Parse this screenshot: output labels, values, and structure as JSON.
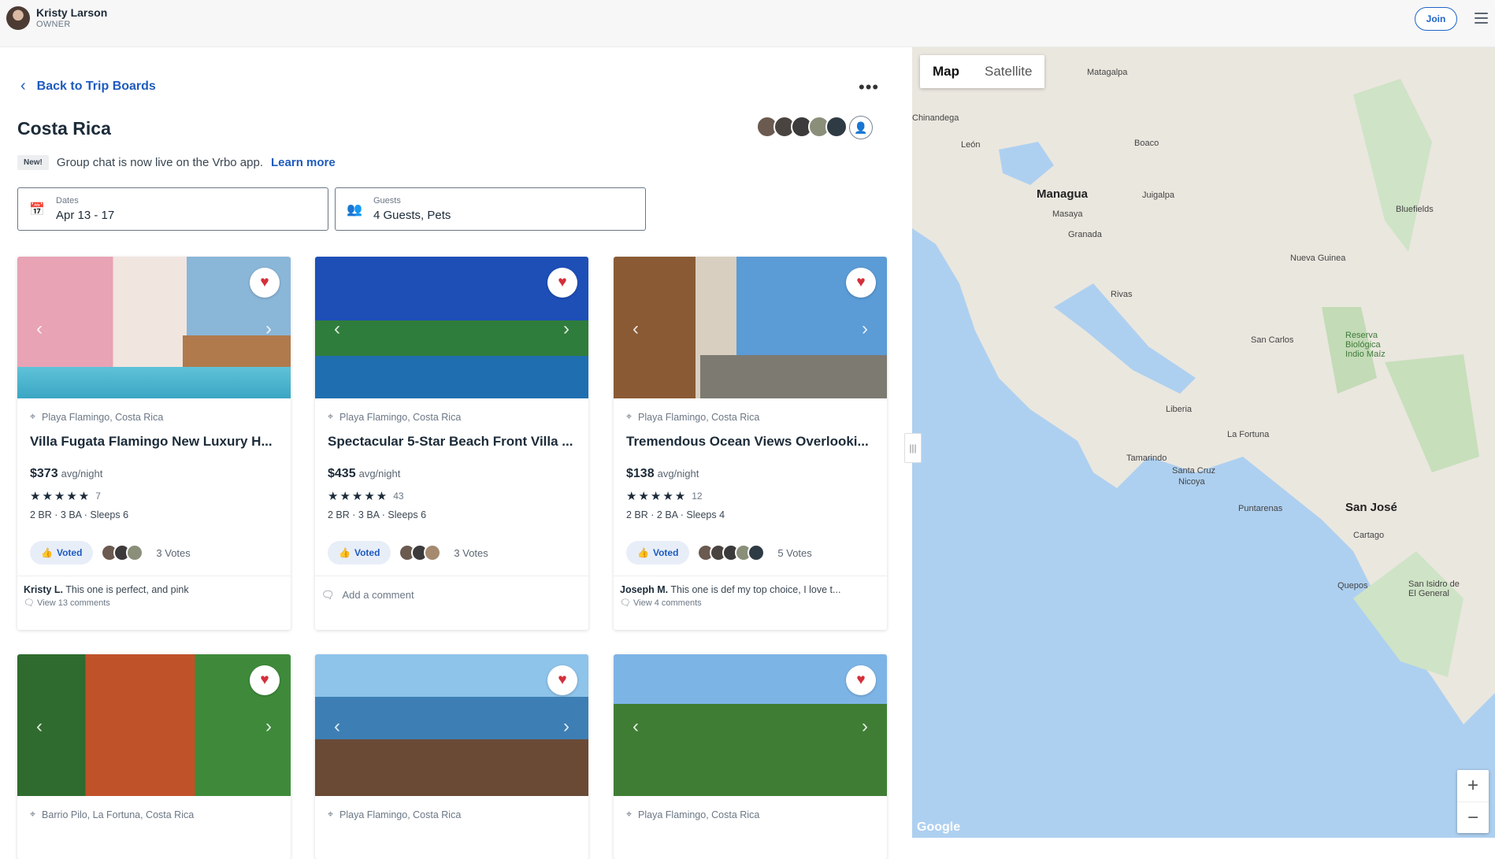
{
  "user": {
    "name": "Kristy Larson",
    "role": "OWNER"
  },
  "header": {
    "join_label": "Join"
  },
  "board": {
    "back_label": "Back to Trip Boards",
    "more_label": "•••",
    "title": "Costa Rica",
    "banner_badge": "New!",
    "banner_text": "Group chat is now live on the Vrbo app.",
    "banner_link": "Learn more",
    "dates_label": "Dates",
    "dates_value": "Apr 13 - 17",
    "guests_label": "Guests",
    "guests_value": "4 Guests, Pets"
  },
  "listings": [
    {
      "location": "Playa Flamingo, Costa Rica",
      "title": "Villa Fugata Flamingo New Luxury H...",
      "price": "$373",
      "price_unit": "avg/night",
      "rating": 5,
      "reviews": "7",
      "specs": "2 BR  ·  3 BA  ·  Sleeps 6",
      "voted_label": "Voted",
      "votes": "3 Votes",
      "comment_author": "Kristy L.",
      "comment_text": "This one is perfect, and pink",
      "comment_link": "View 13 comments"
    },
    {
      "location": "Playa Flamingo, Costa Rica",
      "title": "Spectacular 5-Star Beach Front Villa ...",
      "price": "$435",
      "price_unit": "avg/night",
      "rating": 5,
      "reviews": "43",
      "specs": "2 BR  ·  3 BA  ·  Sleeps 6",
      "voted_label": "Voted",
      "votes": "3 Votes",
      "add_comment": "Add a comment"
    },
    {
      "location": "Playa Flamingo, Costa Rica",
      "title": "Tremendous Ocean Views Overlooki...",
      "price": "$138",
      "price_unit": "avg/night",
      "rating": 5,
      "reviews": "12",
      "specs": "2 BR  ·  2 BA  ·  Sleeps 4",
      "voted_label": "Voted",
      "votes": "5 Votes",
      "comment_author": "Joseph M.",
      "comment_text": "This one is def my top choice, I love t...",
      "comment_link": "View 4 comments"
    },
    {
      "location": "Barrio Pilo, La Fortuna, Costa Rica"
    },
    {
      "location": "Playa Flamingo, Costa Rica"
    },
    {
      "location": "Playa Flamingo, Costa Rica"
    }
  ],
  "map": {
    "tab_map": "Map",
    "tab_satellite": "Satellite",
    "zoom_in": "+",
    "zoom_out": "−",
    "attribution": "Google",
    "cities": [
      "Managua",
      "Masaya",
      "Granada",
      "León",
      "Chinandega",
      "Matagalpa",
      "Boaco",
      "Juigalpa",
      "Rivas",
      "Liberia",
      "Santa Cruz",
      "Nicoya",
      "Puntarenas",
      "San José",
      "Cartago",
      "Tamarindo",
      "La Fortuna",
      "San Carlos",
      "Bluefields",
      "Nueva Guinea",
      "Reserva Biológica Indio Maíz",
      "Quepos",
      "San Isidro de El General"
    ]
  },
  "colors": {
    "accent": "#1e5bbf",
    "favorite": "#d32f3a"
  }
}
